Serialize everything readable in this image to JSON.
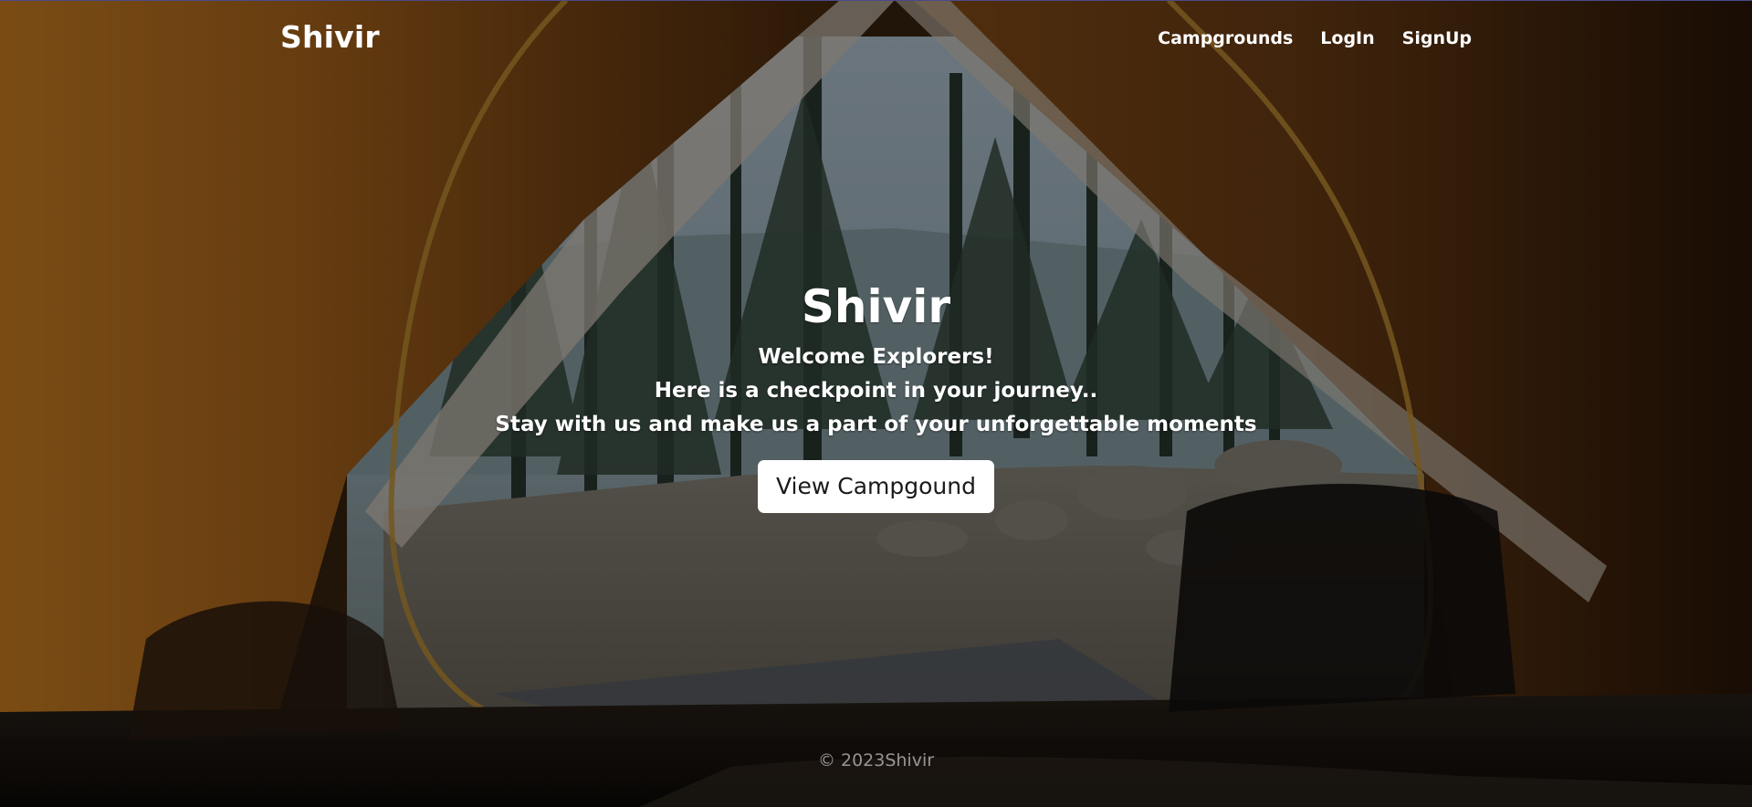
{
  "header": {
    "brand": "Shivir",
    "nav": [
      {
        "label": "Campgrounds"
      },
      {
        "label": "LogIn"
      },
      {
        "label": "SignUp"
      }
    ]
  },
  "hero": {
    "title": "Shivir",
    "lines": [
      "Welcome Explorers!",
      "Here is a checkpoint in your journey..",
      "Stay with us and make us a part of your unforgettable moments"
    ],
    "button_label": "View Campgound"
  },
  "footer": {
    "copyright": "© 2023Shivir"
  },
  "background": {
    "description_icon": "tent-forest-background-image",
    "colors": {
      "tent": "#b06a1f",
      "tent_dark": "#3a1f0a",
      "tent_inner": "#d9cfc2",
      "forest_sky": "#a9bfcf",
      "trees": "#2f3a33",
      "ground": "#8d8476",
      "accent_header_line": "#4b4a8a",
      "button_bg": "#ffffff"
    }
  }
}
